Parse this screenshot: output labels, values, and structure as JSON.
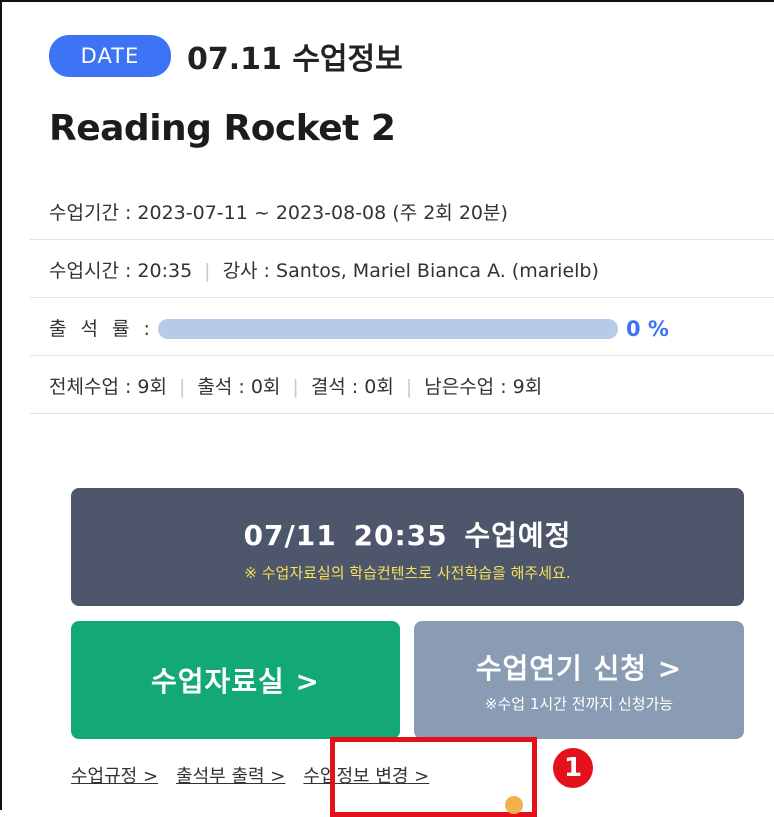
{
  "header": {
    "date_badge": "DATE",
    "date_title": "07.11 수업정보",
    "course_title": "Reading Rocket 2"
  },
  "info": {
    "period": "수업기간 : 2023-07-11 ~ 2023-08-08 (주 2회 20분)",
    "time": "수업시간 : 20:35",
    "teacher": "강사 : Santos, Mariel Bianca A. (marielb)",
    "attendance_label": "출 석 률 :",
    "attendance_value": "0 %",
    "attendance_ratio": 0,
    "total": "전체수업 : 9회",
    "present": "출석 : 0회",
    "absent": "결석 : 0회",
    "remaining": "남은수업 : 9회",
    "separator": "|"
  },
  "schedule": {
    "main": "07/11  20:35  수업예정",
    "note": "※ 수업자료실의 학습컨텐츠로 사전학습을 해주세요."
  },
  "buttons": {
    "materials": "수업자료실 >",
    "postpone": "수업연기 신청 >",
    "postpone_note": "※수업 1시간 전까지 신청가능"
  },
  "links": {
    "rules": "수업규정 >",
    "attendance_print": "출석부 출력 >",
    "change_info": "수업정보 변경 >"
  },
  "annotation": {
    "marker": "1"
  },
  "colors": {
    "accent_blue": "#3d73f5",
    "schedule_bg": "#4d566b",
    "green_button": "#12a877",
    "gray_button": "#8a9bb4",
    "highlight_red": "#e3111b"
  }
}
